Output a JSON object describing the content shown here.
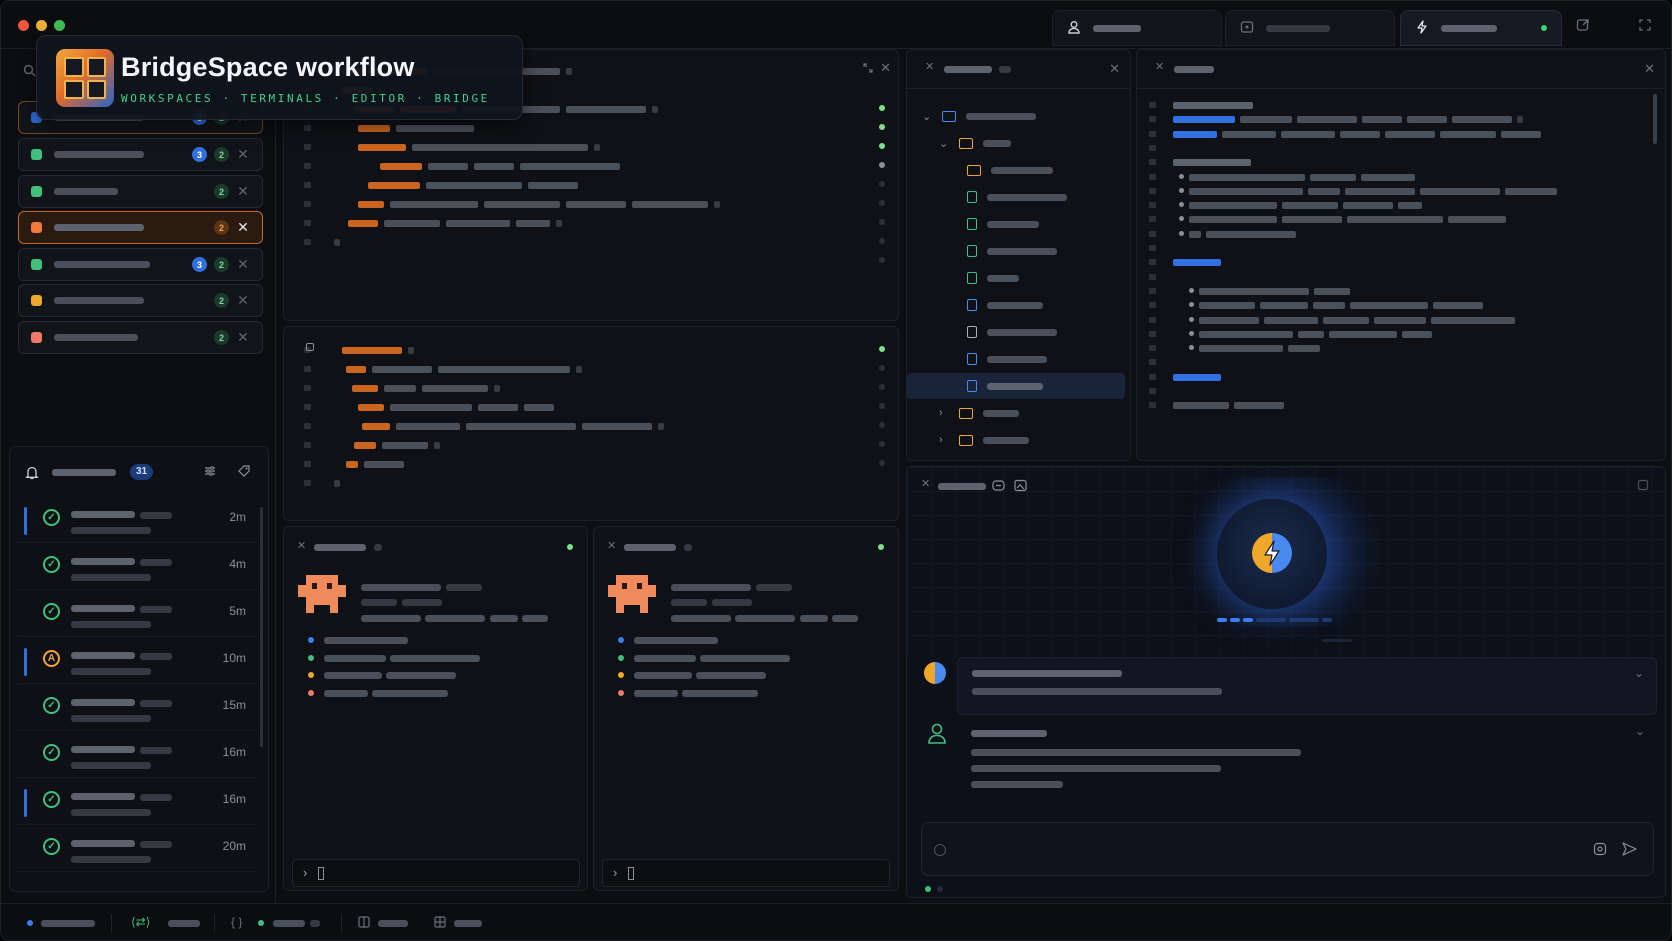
{
  "brand": {
    "title": "BridgeSpace workflow",
    "subtitle": "WORKSPACES · TERMINALS · EDITOR · BRIDGE"
  },
  "window_controls": [
    "close",
    "minimize",
    "maximize"
  ],
  "titlebar": {
    "tabs": [
      {
        "icon": "user-icon",
        "active": false
      },
      {
        "icon": "terminal-icon",
        "active": false
      },
      {
        "icon": "bolt-icon",
        "active": true,
        "status": "online"
      }
    ]
  },
  "workspaces": [
    {
      "color": "#2f6fe0",
      "badges": [
        "3",
        "2"
      ],
      "active": false,
      "highlight": true
    },
    {
      "color": "#3fc07d",
      "badges": [
        "3",
        "2"
      ],
      "active": false
    },
    {
      "color": "#3fc07d",
      "badges": [
        "2"
      ],
      "active": false
    },
    {
      "color": "#f07a3a",
      "badges": [
        "2"
      ],
      "active": true
    },
    {
      "color": "#3fc07d",
      "badges": [
        "3",
        "2"
      ],
      "active": false
    },
    {
      "color": "#f0a82a",
      "badges": [
        "2"
      ],
      "active": false
    },
    {
      "color": "#f07a6a",
      "badges": [
        "2"
      ],
      "active": false
    }
  ],
  "notifications": {
    "count": "31",
    "items": [
      {
        "status": "done",
        "time": "2m",
        "accent": true
      },
      {
        "status": "done",
        "time": "4m",
        "accent": false
      },
      {
        "status": "done",
        "time": "5m",
        "accent": false
      },
      {
        "status": "warn",
        "time": "10m",
        "accent": true
      },
      {
        "status": "done",
        "time": "15m",
        "accent": false
      },
      {
        "status": "done",
        "time": "16m",
        "accent": false
      },
      {
        "status": "done",
        "time": "16m",
        "accent": true
      },
      {
        "status": "done",
        "time": "20m",
        "accent": false
      }
    ]
  },
  "colors": {
    "accent_orange": "#e0782a",
    "accent_blue": "#2f6fe0",
    "accent_green": "#3fc07d",
    "folder_yellow": "#e8a93c"
  },
  "terminal_status": [
    "online",
    "online"
  ]
}
